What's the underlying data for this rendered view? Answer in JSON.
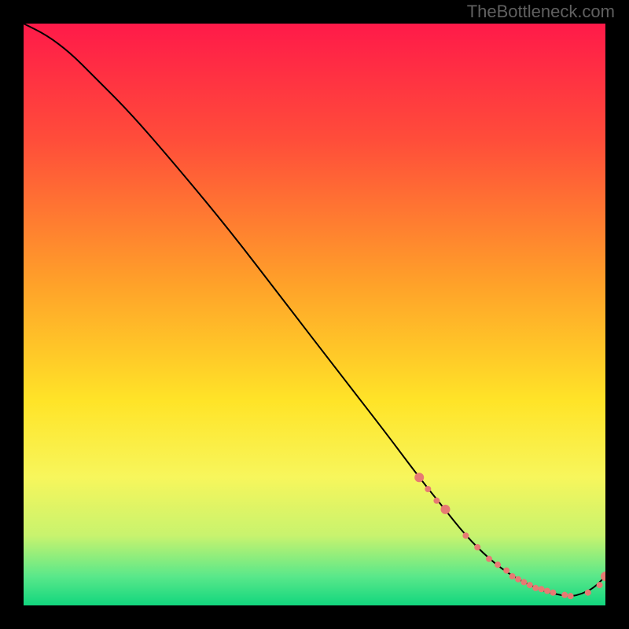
{
  "watermark": "TheBottleneck.com",
  "chart_data": {
    "type": "line",
    "title": "",
    "xlabel": "",
    "ylabel": "",
    "xlim": [
      0,
      100
    ],
    "ylim": [
      0,
      100
    ],
    "gradient_stops": [
      {
        "offset": 0,
        "color": "#ff1a49"
      },
      {
        "offset": 20,
        "color": "#ff4d3a"
      },
      {
        "offset": 45,
        "color": "#ffa229"
      },
      {
        "offset": 65,
        "color": "#ffe428"
      },
      {
        "offset": 78,
        "color": "#f7f65c"
      },
      {
        "offset": 88,
        "color": "#c8f36e"
      },
      {
        "offset": 95,
        "color": "#5ae88a"
      },
      {
        "offset": 100,
        "color": "#12d67e"
      }
    ],
    "series": [
      {
        "name": "curve",
        "type": "line",
        "x": [
          0,
          4,
          8,
          12,
          18,
          25,
          35,
          45,
          55,
          62,
          68,
          72,
          76,
          80,
          84,
          88,
          91,
          94,
          96,
          98,
          100
        ],
        "y": [
          100,
          98,
          95,
          91,
          85,
          77,
          65,
          52,
          39,
          30,
          22,
          17,
          12,
          8,
          5,
          3,
          2,
          1.5,
          2,
          3,
          5
        ],
        "stroke": "#000000",
        "stroke_width": 2
      },
      {
        "name": "markers",
        "type": "scatter",
        "x": [
          68,
          69.5,
          71,
          72.5,
          76,
          78,
          80,
          81.5,
          83,
          84,
          85,
          86,
          87,
          88,
          89,
          90,
          91,
          93,
          94,
          97,
          99,
          100
        ],
        "y": [
          22,
          20,
          18,
          16.5,
          12,
          10,
          8,
          7,
          6,
          5,
          4.5,
          4,
          3.5,
          3,
          2.8,
          2.5,
          2.2,
          1.8,
          1.6,
          2.2,
          3.5,
          5
        ],
        "fill": "#e77a73",
        "radius_small": 4,
        "radius_large": 6,
        "large_indices": [
          0,
          3,
          21
        ]
      }
    ]
  }
}
